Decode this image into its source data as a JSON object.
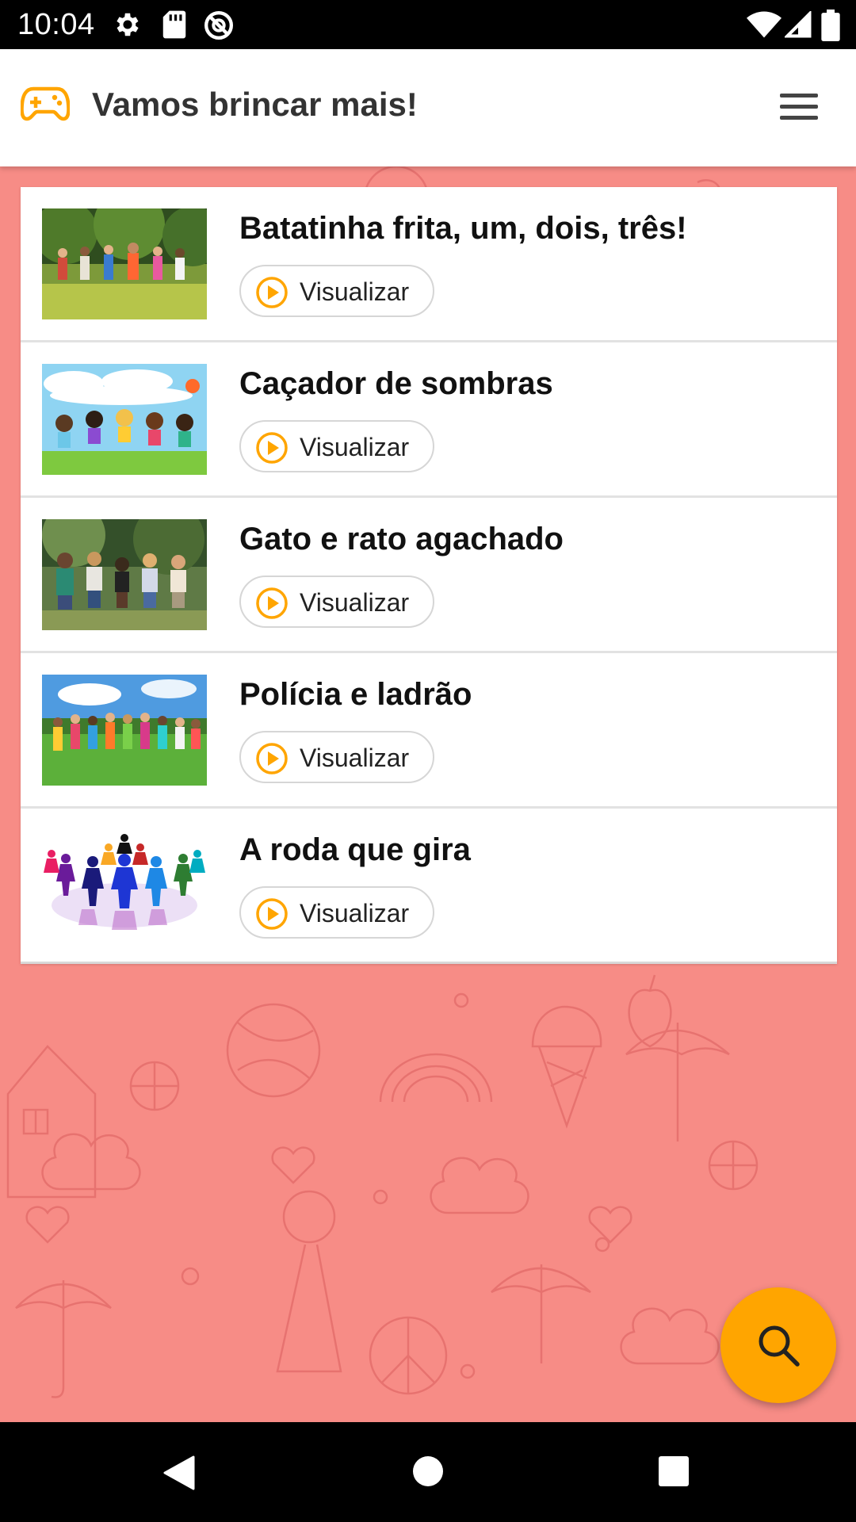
{
  "status_bar": {
    "time": "10:04"
  },
  "app_bar": {
    "title": "Vamos brincar mais!",
    "logo_icon": "gamepad-icon",
    "menu_icon": "hamburger-menu-icon"
  },
  "colors": {
    "accent": "#ffa500",
    "background": "#f78c86",
    "card": "#ffffff"
  },
  "games": [
    {
      "title": "Batatinha frita, um, dois, três!",
      "button_label": "Visualizar",
      "thumbnail": "children-running-in-park-photo"
    },
    {
      "title": "Caçador de sombras",
      "button_label": "Visualizar",
      "thumbnail": "cartoon-kids-jumping-illustration"
    },
    {
      "title": "Gato e rato agachado",
      "button_label": "Visualizar",
      "thumbnail": "kids-group-photo"
    },
    {
      "title": "Polícia e ladrão",
      "button_label": "Visualizar",
      "thumbnail": "kids-running-on-grass-photo"
    },
    {
      "title": "A roda que gira",
      "button_label": "Visualizar",
      "thumbnail": "paper-chain-people-circle"
    }
  ],
  "fab": {
    "icon": "search-icon"
  },
  "nav_bar": {
    "back": "back-icon",
    "home": "home-icon",
    "recents": "recents-icon"
  }
}
